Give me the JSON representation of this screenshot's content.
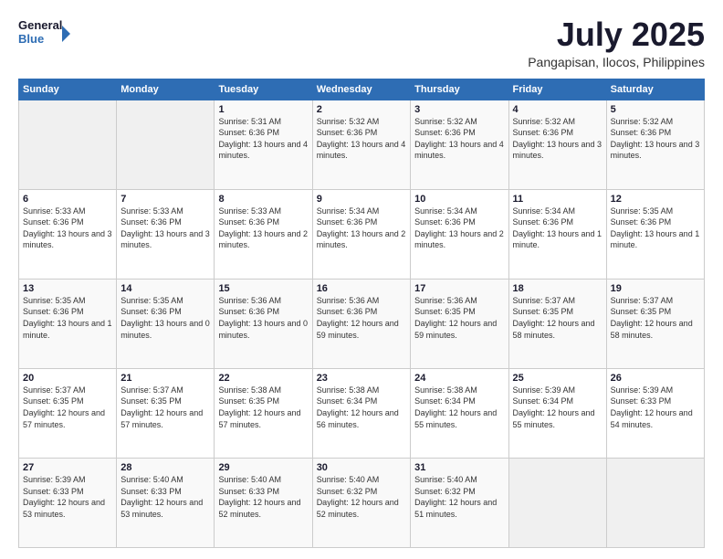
{
  "logo": {
    "line1": "General",
    "line2": "Blue"
  },
  "title": "July 2025",
  "subtitle": "Pangapisan, Ilocos, Philippines",
  "weekdays": [
    "Sunday",
    "Monday",
    "Tuesday",
    "Wednesday",
    "Thursday",
    "Friday",
    "Saturday"
  ],
  "weeks": [
    [
      {
        "day": "",
        "detail": ""
      },
      {
        "day": "",
        "detail": ""
      },
      {
        "day": "1",
        "detail": "Sunrise: 5:31 AM\nSunset: 6:36 PM\nDaylight: 13 hours and 4 minutes."
      },
      {
        "day": "2",
        "detail": "Sunrise: 5:32 AM\nSunset: 6:36 PM\nDaylight: 13 hours and 4 minutes."
      },
      {
        "day": "3",
        "detail": "Sunrise: 5:32 AM\nSunset: 6:36 PM\nDaylight: 13 hours and 4 minutes."
      },
      {
        "day": "4",
        "detail": "Sunrise: 5:32 AM\nSunset: 6:36 PM\nDaylight: 13 hours and 3 minutes."
      },
      {
        "day": "5",
        "detail": "Sunrise: 5:32 AM\nSunset: 6:36 PM\nDaylight: 13 hours and 3 minutes."
      }
    ],
    [
      {
        "day": "6",
        "detail": "Sunrise: 5:33 AM\nSunset: 6:36 PM\nDaylight: 13 hours and 3 minutes."
      },
      {
        "day": "7",
        "detail": "Sunrise: 5:33 AM\nSunset: 6:36 PM\nDaylight: 13 hours and 3 minutes."
      },
      {
        "day": "8",
        "detail": "Sunrise: 5:33 AM\nSunset: 6:36 PM\nDaylight: 13 hours and 2 minutes."
      },
      {
        "day": "9",
        "detail": "Sunrise: 5:34 AM\nSunset: 6:36 PM\nDaylight: 13 hours and 2 minutes."
      },
      {
        "day": "10",
        "detail": "Sunrise: 5:34 AM\nSunset: 6:36 PM\nDaylight: 13 hours and 2 minutes."
      },
      {
        "day": "11",
        "detail": "Sunrise: 5:34 AM\nSunset: 6:36 PM\nDaylight: 13 hours and 1 minute."
      },
      {
        "day": "12",
        "detail": "Sunrise: 5:35 AM\nSunset: 6:36 PM\nDaylight: 13 hours and 1 minute."
      }
    ],
    [
      {
        "day": "13",
        "detail": "Sunrise: 5:35 AM\nSunset: 6:36 PM\nDaylight: 13 hours and 1 minute."
      },
      {
        "day": "14",
        "detail": "Sunrise: 5:35 AM\nSunset: 6:36 PM\nDaylight: 13 hours and 0 minutes."
      },
      {
        "day": "15",
        "detail": "Sunrise: 5:36 AM\nSunset: 6:36 PM\nDaylight: 13 hours and 0 minutes."
      },
      {
        "day": "16",
        "detail": "Sunrise: 5:36 AM\nSunset: 6:36 PM\nDaylight: 12 hours and 59 minutes."
      },
      {
        "day": "17",
        "detail": "Sunrise: 5:36 AM\nSunset: 6:35 PM\nDaylight: 12 hours and 59 minutes."
      },
      {
        "day": "18",
        "detail": "Sunrise: 5:37 AM\nSunset: 6:35 PM\nDaylight: 12 hours and 58 minutes."
      },
      {
        "day": "19",
        "detail": "Sunrise: 5:37 AM\nSunset: 6:35 PM\nDaylight: 12 hours and 58 minutes."
      }
    ],
    [
      {
        "day": "20",
        "detail": "Sunrise: 5:37 AM\nSunset: 6:35 PM\nDaylight: 12 hours and 57 minutes."
      },
      {
        "day": "21",
        "detail": "Sunrise: 5:37 AM\nSunset: 6:35 PM\nDaylight: 12 hours and 57 minutes."
      },
      {
        "day": "22",
        "detail": "Sunrise: 5:38 AM\nSunset: 6:35 PM\nDaylight: 12 hours and 57 minutes."
      },
      {
        "day": "23",
        "detail": "Sunrise: 5:38 AM\nSunset: 6:34 PM\nDaylight: 12 hours and 56 minutes."
      },
      {
        "day": "24",
        "detail": "Sunrise: 5:38 AM\nSunset: 6:34 PM\nDaylight: 12 hours and 55 minutes."
      },
      {
        "day": "25",
        "detail": "Sunrise: 5:39 AM\nSunset: 6:34 PM\nDaylight: 12 hours and 55 minutes."
      },
      {
        "day": "26",
        "detail": "Sunrise: 5:39 AM\nSunset: 6:33 PM\nDaylight: 12 hours and 54 minutes."
      }
    ],
    [
      {
        "day": "27",
        "detail": "Sunrise: 5:39 AM\nSunset: 6:33 PM\nDaylight: 12 hours and 53 minutes."
      },
      {
        "day": "28",
        "detail": "Sunrise: 5:40 AM\nSunset: 6:33 PM\nDaylight: 12 hours and 53 minutes."
      },
      {
        "day": "29",
        "detail": "Sunrise: 5:40 AM\nSunset: 6:33 PM\nDaylight: 12 hours and 52 minutes."
      },
      {
        "day": "30",
        "detail": "Sunrise: 5:40 AM\nSunset: 6:32 PM\nDaylight: 12 hours and 52 minutes."
      },
      {
        "day": "31",
        "detail": "Sunrise: 5:40 AM\nSunset: 6:32 PM\nDaylight: 12 hours and 51 minutes."
      },
      {
        "day": "",
        "detail": ""
      },
      {
        "day": "",
        "detail": ""
      }
    ]
  ]
}
